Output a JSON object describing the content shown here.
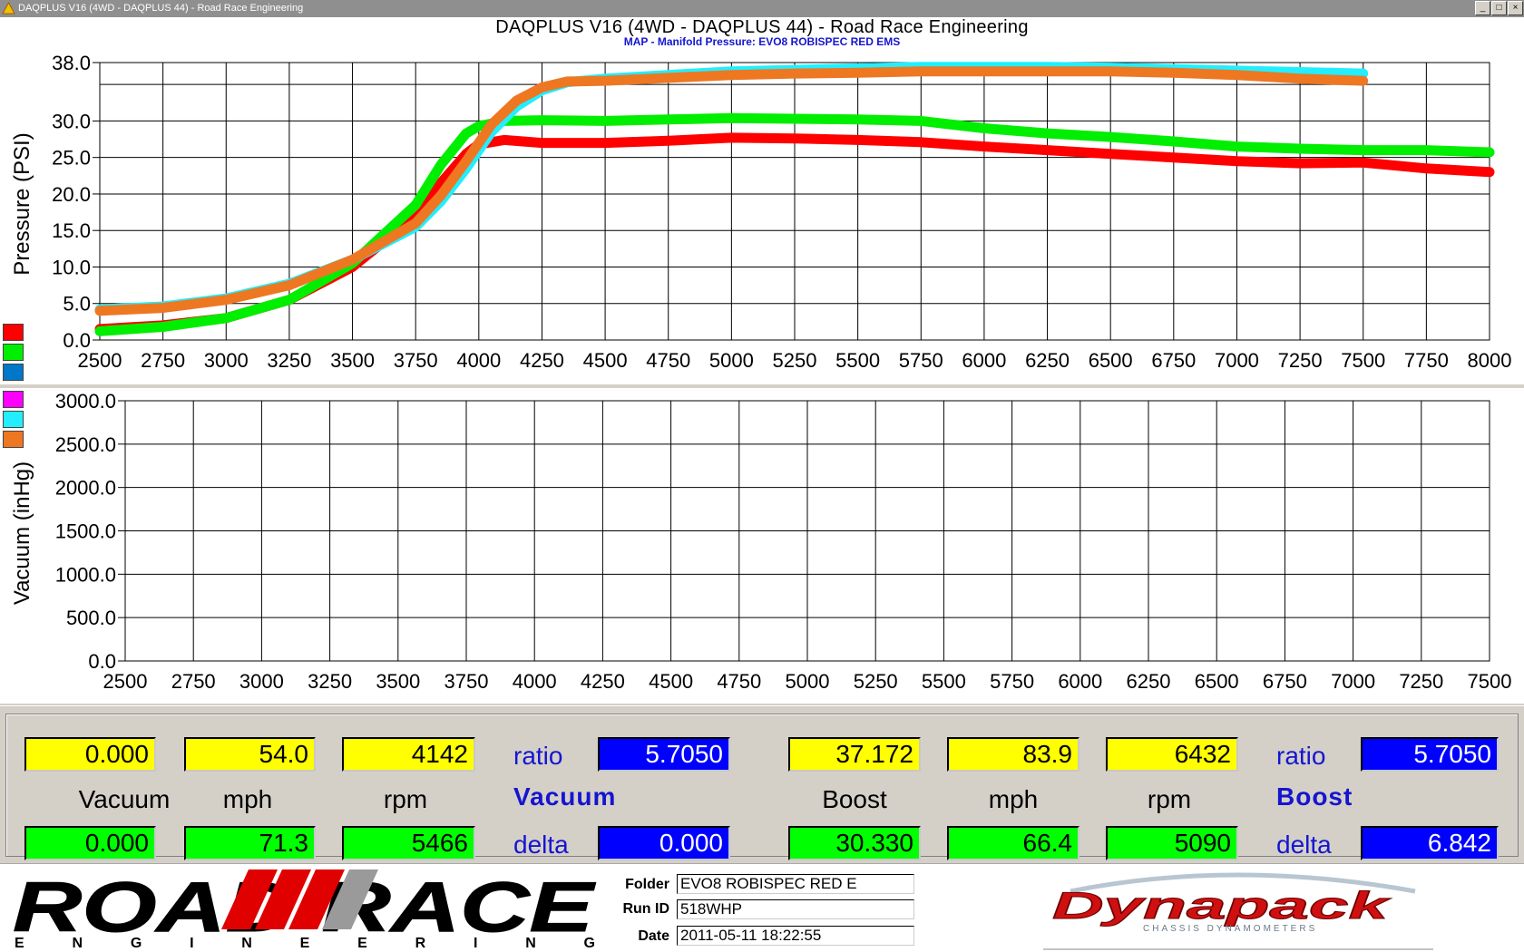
{
  "window": {
    "title": "DAQPLUS V16 (4WD - DAQPLUS 44) - Road Race Engineering",
    "min_label": "_",
    "max_label": "□",
    "close_label": "×"
  },
  "header": {
    "title": "DAQPLUS V16 (4WD - DAQPLUS 44) - Road Race Engineering",
    "subtitle": "MAP - Manifold Pressure: EVO8 ROBISPEC RED EMS"
  },
  "colors": {
    "red": "#ff0000",
    "green": "#00ee00",
    "blue": "#0077c8",
    "magenta": "#ff00ff",
    "cyan": "#22eeff",
    "orange": "#ee7722",
    "value_blue": "#0000ff",
    "label_blue": "#1515d0"
  },
  "chart_data": [
    {
      "type": "line",
      "ylabel": "Pressure (PSI)",
      "xlim": [
        2500,
        8000
      ],
      "ylim": [
        0,
        38
      ],
      "grid": true,
      "x_ticks": [
        "2500",
        "2750",
        "3000",
        "3250",
        "3500",
        "3750",
        "4000",
        "4250",
        "4500",
        "4750",
        "5000",
        "5250",
        "5500",
        "5750",
        "6000",
        "6250",
        "6500",
        "6750",
        "7000",
        "7250",
        "7500",
        "7750",
        "8000"
      ],
      "y_ticks": [
        "0.0",
        "5.0",
        "10.0",
        "15.0",
        "20.0",
        "25.0",
        "30.0",
        "38.0"
      ],
      "y_tick_values": [
        0,
        5,
        10,
        15,
        20,
        25,
        30,
        38
      ],
      "extra_gridline_y": 35,
      "series": [
        {
          "color_key": "red",
          "x": [
            2500,
            2750,
            3000,
            3250,
            3500,
            3750,
            3850,
            3950,
            4000,
            4100,
            4250,
            4500,
            4750,
            5000,
            5250,
            5500,
            5750,
            6000,
            6250,
            6500,
            6750,
            7000,
            7250,
            7500,
            7750,
            8000
          ],
          "y": [
            1.5,
            2.0,
            3.0,
            5.5,
            10.0,
            17.0,
            21.5,
            25.5,
            26.8,
            27.4,
            27.0,
            27.0,
            27.3,
            27.7,
            27.6,
            27.4,
            27.1,
            26.5,
            26.0,
            25.5,
            25.0,
            24.5,
            24.2,
            24.3,
            23.5,
            23.0
          ]
        },
        {
          "color_key": "green",
          "x": [
            2500,
            2750,
            3000,
            3250,
            3500,
            3750,
            3850,
            3950,
            4000,
            4100,
            4250,
            4500,
            4750,
            5000,
            5250,
            5500,
            5750,
            6000,
            6250,
            6500,
            6750,
            7000,
            7250,
            7500,
            7750,
            8000
          ],
          "y": [
            1.2,
            1.8,
            3.0,
            5.5,
            10.5,
            18.5,
            24.0,
            28.3,
            29.3,
            30.0,
            30.1,
            30.0,
            30.2,
            30.4,
            30.3,
            30.2,
            30.0,
            29.0,
            28.3,
            27.8,
            27.2,
            26.5,
            26.2,
            26.0,
            26.0,
            25.7
          ]
        },
        {
          "color_key": "cyan",
          "x": [
            2500,
            2750,
            3000,
            3250,
            3500,
            3750,
            3850,
            3950,
            4050,
            4150,
            4250,
            4350,
            4500,
            4750,
            5000,
            5250,
            5500,
            5750,
            6000,
            6250,
            6500,
            6750,
            7000,
            7250,
            7500
          ],
          "y": [
            4.2,
            4.6,
            5.7,
            7.7,
            11.0,
            15.5,
            19.0,
            23.5,
            28.5,
            32.0,
            34.2,
            35.3,
            35.8,
            36.3,
            36.8,
            37.0,
            37.2,
            37.4,
            37.4,
            37.4,
            37.3,
            37.1,
            36.9,
            36.7,
            36.5
          ]
        },
        {
          "color_key": "orange",
          "x": [
            2500,
            2750,
            3000,
            3250,
            3500,
            3750,
            3850,
            3950,
            4050,
            4150,
            4250,
            4350,
            4500,
            4750,
            5000,
            5250,
            5500,
            5750,
            6000,
            6250,
            6500,
            6750,
            7000,
            7250,
            7500
          ],
          "y": [
            4.0,
            4.4,
            5.5,
            7.5,
            11.0,
            16.0,
            19.8,
            24.5,
            29.5,
            32.8,
            34.6,
            35.4,
            35.5,
            35.9,
            36.3,
            36.5,
            36.6,
            36.8,
            36.8,
            36.8,
            36.8,
            36.6,
            36.3,
            35.8,
            35.5
          ]
        }
      ]
    },
    {
      "type": "line",
      "ylabel": "Vacuum (inHg)",
      "xlim": [
        2500,
        7500
      ],
      "ylim": [
        0,
        3000
      ],
      "grid": true,
      "x_ticks": [
        "2500",
        "2750",
        "3000",
        "3250",
        "3500",
        "3750",
        "4000",
        "4250",
        "4500",
        "4750",
        "5000",
        "5250",
        "5500",
        "5750",
        "6000",
        "6250",
        "6500",
        "6750",
        "7000",
        "7250",
        "7500"
      ],
      "y_ticks": [
        "0.0",
        "500.0",
        "1000.0",
        "1500.0",
        "2000.0",
        "2500.0",
        "3000.0"
      ],
      "y_tick_values": [
        0,
        500,
        1000,
        1500,
        2000,
        2500,
        3000
      ],
      "series": []
    }
  ],
  "legend": [
    "red",
    "green",
    "blue",
    "magenta",
    "cyan",
    "orange"
  ],
  "metrics": {
    "left": {
      "yellow": [
        "0.000",
        "54.0",
        "4142"
      ],
      "green": [
        "0.000",
        "71.3",
        "5466"
      ],
      "labels": [
        "Vacuum",
        "mph",
        "rpm"
      ],
      "ratio_label": "ratio",
      "ratio_value": "5.7050",
      "heading": "Vacuum",
      "delta_label": "delta",
      "delta_value": "0.000"
    },
    "right": {
      "yellow": [
        "37.172",
        "83.9",
        "6432"
      ],
      "green": [
        "30.330",
        "66.4",
        "5090"
      ],
      "labels": [
        "Boost",
        "mph",
        "rpm"
      ],
      "ratio_label": "ratio",
      "ratio_value": "5.7050",
      "heading": "Boost",
      "delta_label": "delta",
      "delta_value": "6.842"
    }
  },
  "footer": {
    "logo_text": "ROAD RACE",
    "logo_sub": "E N G I N E E R I N G",
    "folder_label": "Folder",
    "folder_value": "EVO8 ROBISPEC RED E",
    "runid_label": "Run ID",
    "runid_value": "518WHP",
    "date_label": "Date",
    "date_value": "2011-05-11 18:22:55",
    "dyno_logo": "Dynapack",
    "dyno_sub": "CHASSIS DYNAMOMETERS"
  }
}
